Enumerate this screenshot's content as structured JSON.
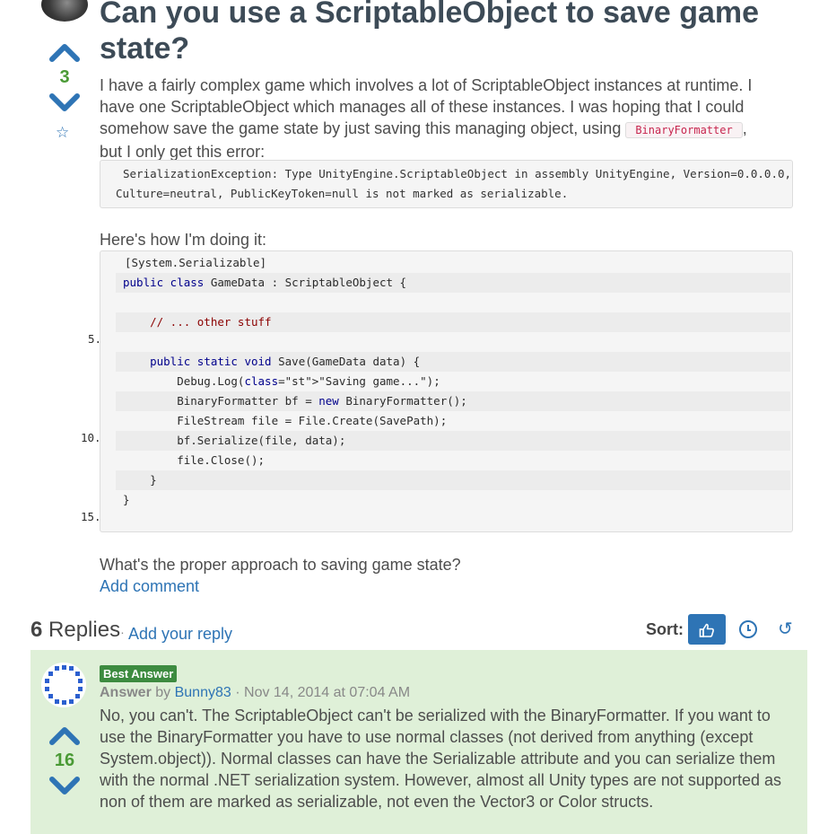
{
  "question": {
    "title": "Can you use a ScriptableObject to save game state?",
    "votes": "3",
    "body_before_code": "I have a fairly complex game which involves a lot of ScriptableObject instances at runtime. I have one ScriptableObject which manages all of these instances. I was hoping that I could somehow save the game state by just saving this managing object, using ",
    "inline_code": "BinaryFormatter",
    "body_after_code": ",",
    "body_error_intro": "but I only get this error:",
    "error_line_1": "SerializationException: Type UnityEngine.ScriptableObject in assembly UnityEngine, Version=0.0.0.0,",
    "error_line_2": "Culture=neutral, PublicKeyToken=null is not marked as serializable.",
    "how_text": "Here's how I'm doing it:",
    "code_lines": [
      "[System.Serializable]",
      "public class GameData : ScriptableObject {",
      "",
      "    // ... other stuff",
      "",
      "    public static void Save(GameData data) {",
      "        Debug.Log(\"Saving game...\");",
      "        BinaryFormatter bf = new BinaryFormatter();",
      "        FileStream file = File.Create(SavePath);",
      "        bf.Serialize(file, data);",
      "        file.Close();",
      "    }",
      "}",
      ""
    ],
    "line_numbers": [
      "5.",
      "10.",
      "15."
    ],
    "closing_text": "What's the proper approach to saving game state?",
    "add_comment": "Add comment"
  },
  "replies": {
    "count": "6",
    "label": "Replies",
    "separator": "·",
    "add_reply": "Add your reply",
    "sort_label": "Sort:"
  },
  "answer": {
    "badge": "Best Answer",
    "answer_label": "Answer",
    "by": "by",
    "author": "Bunny83",
    "date": "· Nov 14, 2014 at 07:04 AM",
    "votes": "16",
    "body": "No, you can't. The ScriptableObject can't be serialized with the BinaryFormatter. If you want to use the BinaryFormatter you have to use normal classes (not derived from anything (except System.object)). Normal classes can have the Serializable attribute and you can serialize them with the normal .NET serialization system. However, almost all Unity types are not supported as non of them are marked as serializable, not even the Vector3 or Color structs."
  },
  "icons": {
    "vote_up": "chevron-up-icon",
    "vote_down": "chevron-down-icon",
    "favorite": "star-icon",
    "sort_votes": "thumbs-up-icon",
    "sort_newest": "clock-icon",
    "sort_oldest": "history-icon"
  },
  "colors": {
    "link": "#2e74b5",
    "vote_count": "#4a9a35",
    "best_answer_badge": "#3d8b40",
    "answer_bg": "#dff0d8",
    "title": "#3d4b57"
  }
}
